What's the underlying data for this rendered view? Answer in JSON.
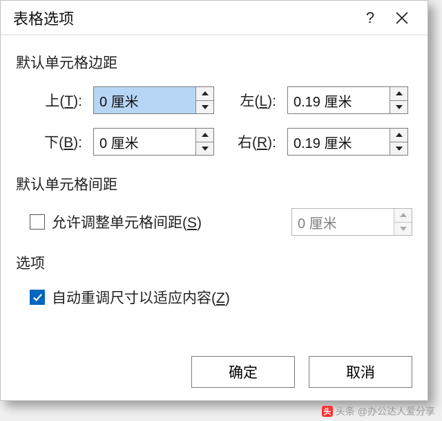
{
  "titlebar": {
    "title": "表格选项",
    "help": "?"
  },
  "sections": {
    "margins_label": "默认单元格边距",
    "spacing_label": "默认单元格间距",
    "options_label": "选项"
  },
  "margins": {
    "top": {
      "label_pre": "上(",
      "hotkey": "T",
      "label_post": "):",
      "value": "0 厘米"
    },
    "left": {
      "label_pre": "左(",
      "hotkey": "L",
      "label_post": "):",
      "value": "0.19 厘米"
    },
    "bottom": {
      "label_pre": "下(",
      "hotkey": "B",
      "label_post": "):",
      "value": "0 厘米"
    },
    "right": {
      "label_pre": "右(",
      "hotkey": "R",
      "label_post": "):",
      "value": "0.19 厘米"
    }
  },
  "spacing": {
    "checkbox_pre": "允许调整单元格间距(",
    "checkbox_hotkey": "S",
    "checkbox_post": ")",
    "value": "0 厘米"
  },
  "options": {
    "resize_pre": "自动重调尺寸以适应内容(",
    "resize_hotkey": "Z",
    "resize_post": ")"
  },
  "footer": {
    "ok": "确定",
    "cancel": "取消"
  },
  "watermark": "头条 @办公达人爱分享"
}
